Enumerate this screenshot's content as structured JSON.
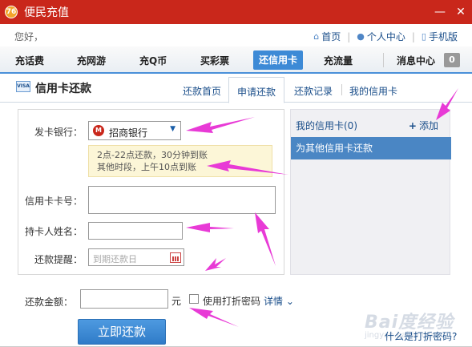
{
  "window": {
    "title": "便民充值",
    "logo_text": "76",
    "buttons": [
      "—",
      "✕"
    ]
  },
  "userbar": {
    "greeting": "您好，",
    "links": [
      {
        "icon": "home-icon",
        "label": "首页"
      },
      {
        "icon": "person-icon",
        "label": "个人中心"
      },
      {
        "icon": "phone-icon",
        "label": "手机版"
      }
    ]
  },
  "nav": {
    "items": [
      "充话费",
      "充网游",
      "充Q币",
      "买彩票",
      "还信用卡",
      "充流量"
    ],
    "active_index": 4,
    "messages_label": "消息中心",
    "messages_count": "0"
  },
  "section": {
    "card_icon_text": "VISA",
    "title": "信用卡还款",
    "tabs": [
      "还款首页",
      "申请还款",
      "还款记录",
      "我的信用卡"
    ],
    "active_tab": 1
  },
  "form": {
    "bank_label": "发卡银行：",
    "bank_value": "招商银行",
    "tip_line1": "2点-22点还款，30分钟到账",
    "tip_line2": "其他时段，上午10点到账",
    "card_number_label": "信用卡卡号：",
    "card_number_value": "",
    "holder_label": "持卡人姓名：",
    "holder_value": "",
    "reminder_label": "还款提醒：",
    "reminder_placeholder": "到期还款日",
    "amount_label": "还款金额：",
    "amount_value": "",
    "currency": "元",
    "discount_pwd_label": "使用打折密码",
    "details_label": "详情",
    "submit_label": "立即还款",
    "help_link": "什么是打折密码?"
  },
  "right_panel": {
    "my_cards": "我的信用卡(0)",
    "add_label": "添加",
    "pay_others": "为其他信用卡还款"
  },
  "watermark": {
    "text": "Bai度经验",
    "sub": "jingyan.baidu.com"
  },
  "colors": {
    "title_bar": "#c9271b",
    "nav_active": "#3d8ad6",
    "annotation_arrows": "#e83ad6",
    "selected_panel_row": "#4a86c4"
  }
}
